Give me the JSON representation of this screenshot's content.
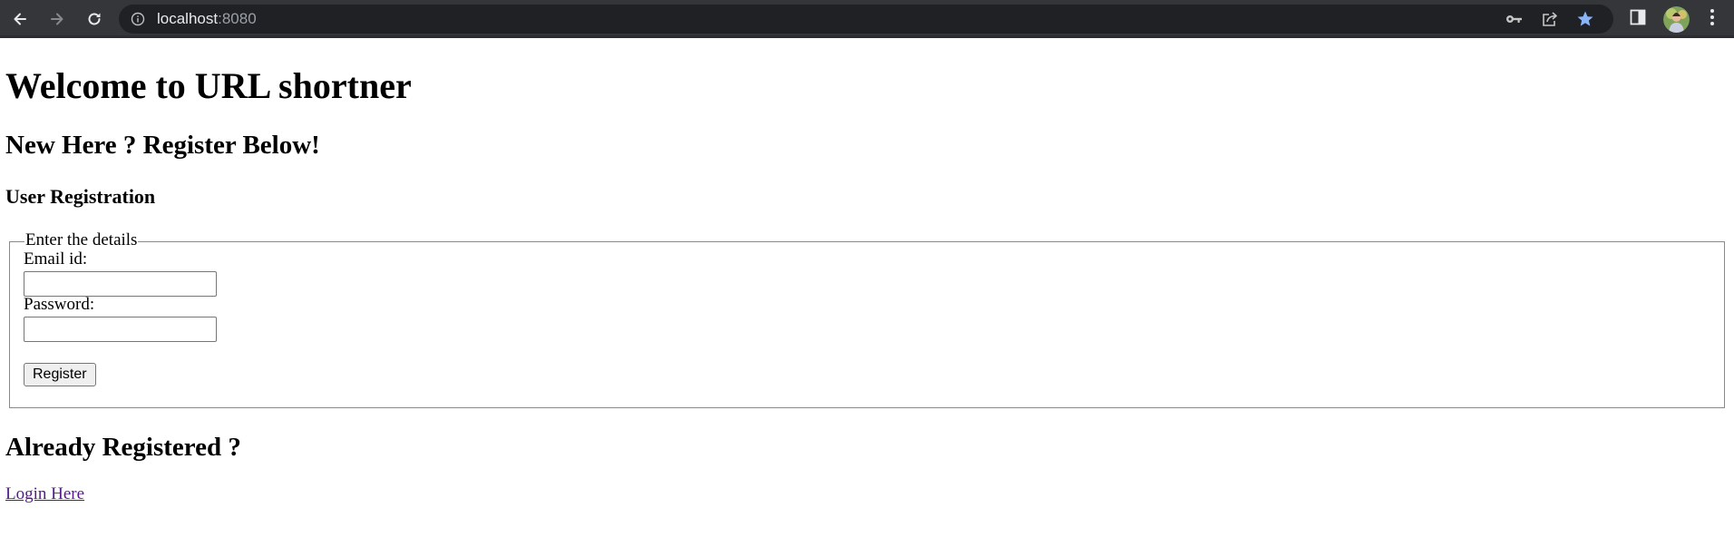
{
  "browser": {
    "url_host": "localhost",
    "url_port": ":8080",
    "icons": {
      "back": "back-arrow-icon",
      "forward": "forward-arrow-icon",
      "reload": "reload-icon",
      "site_info": "info-icon",
      "passwords": "key-icon",
      "share": "share-icon",
      "bookmark": "star-icon",
      "side_panel": "side-panel-icon",
      "profile": "avatar",
      "menu": "kebab-menu-icon"
    },
    "colors": {
      "toolbar": "#35363a",
      "omnibox": "#202124",
      "bookmark_star": "#8ab4f8"
    }
  },
  "page": {
    "title": "Welcome to URL shortner",
    "register_heading": "New Here ? Register Below!",
    "registration_subheading": "User Registration",
    "form": {
      "legend": "Enter the details",
      "email_label": "Email id:",
      "email_value": "",
      "password_label": "Password:",
      "password_value": "",
      "submit_label": "Register"
    },
    "login_heading": "Already Registered ?",
    "login_link": "Login Here",
    "colors": {
      "link": "#551a8b"
    }
  }
}
